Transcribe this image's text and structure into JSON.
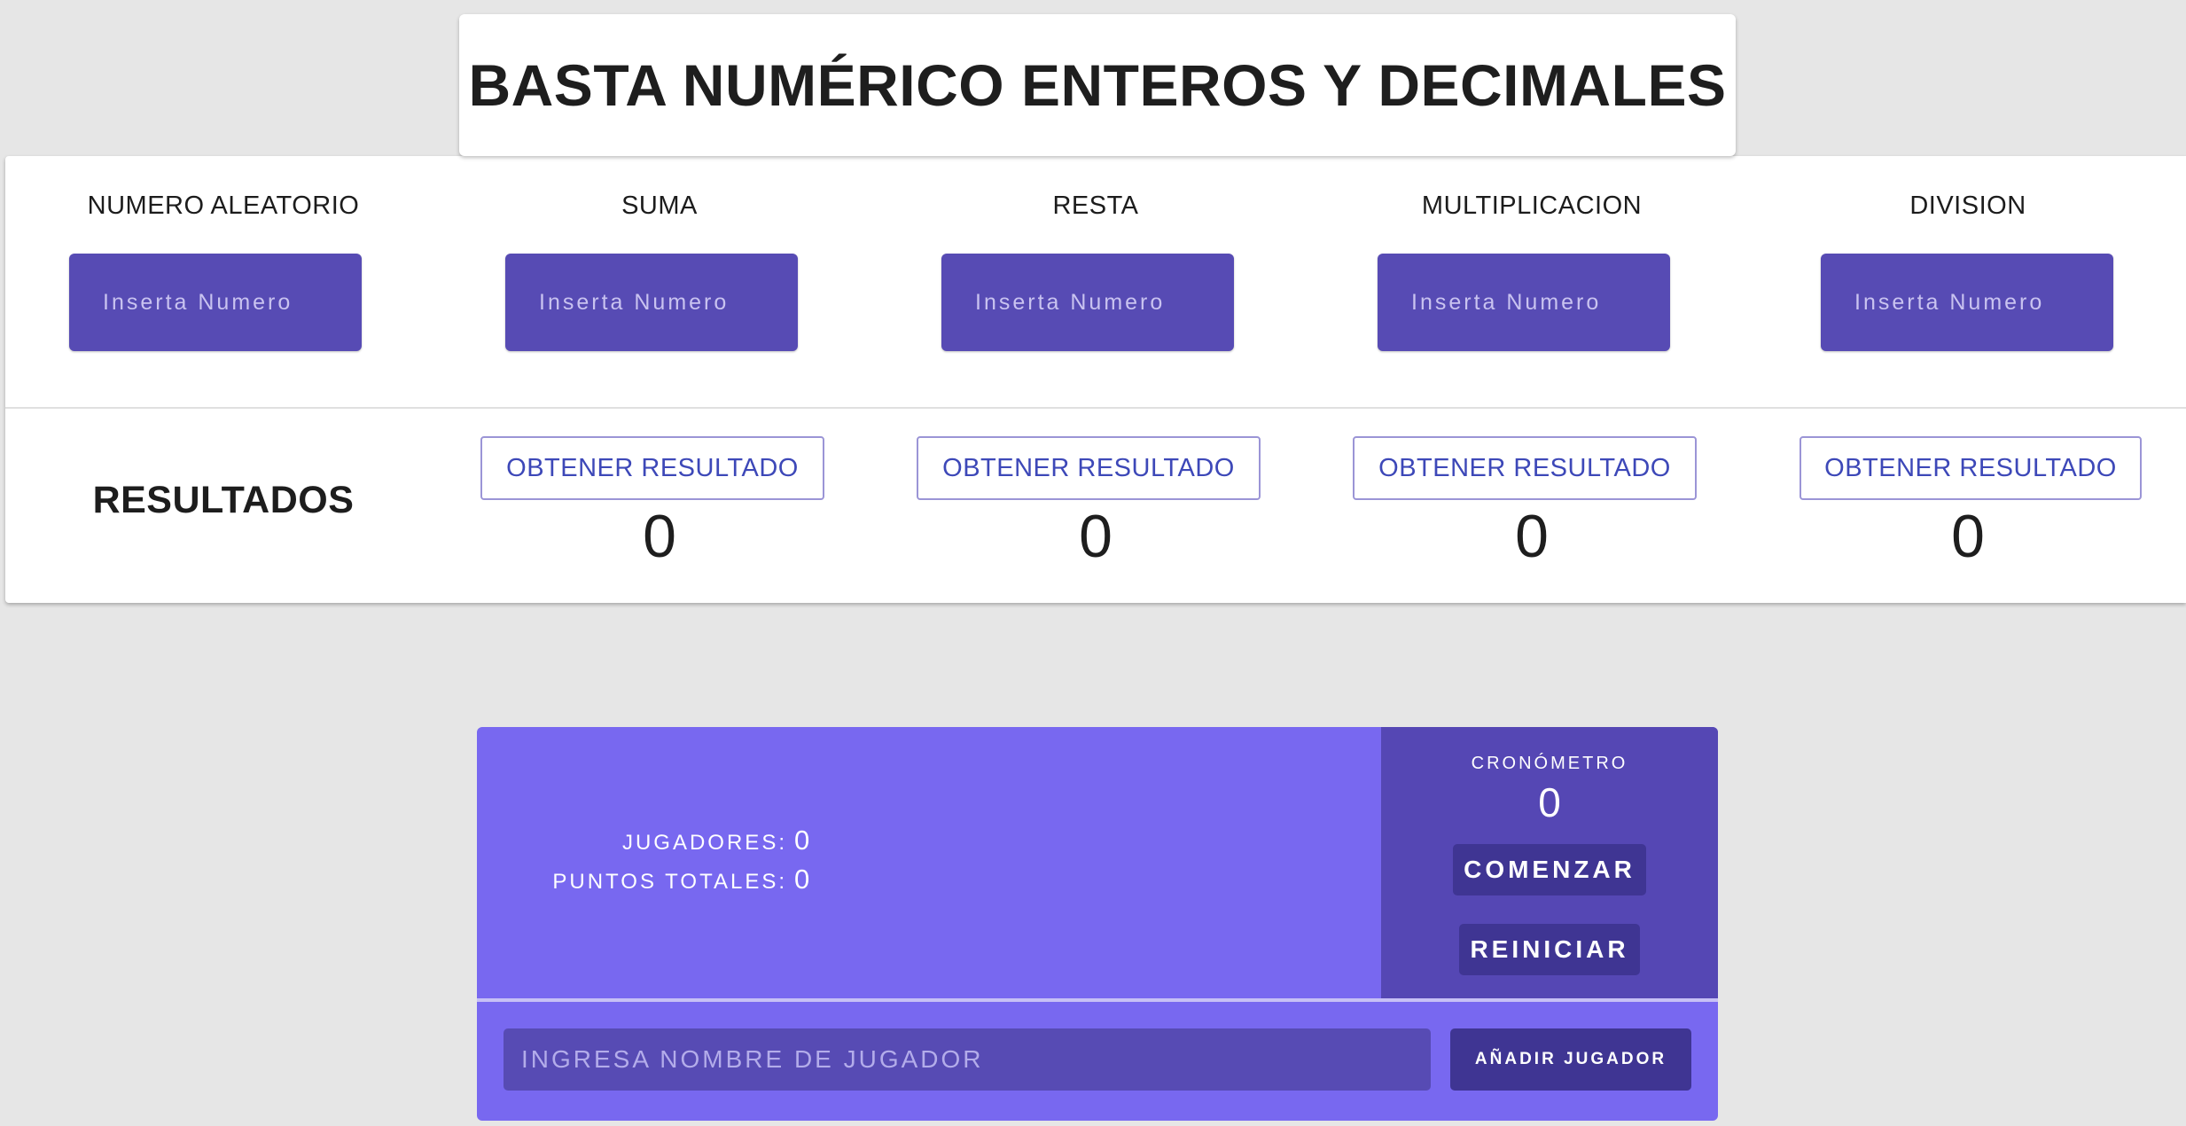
{
  "title": "BASTA NUMÉRICO ENTEROS Y DECIMALES",
  "columns": [
    {
      "header": "NUMERO ALEATORIO",
      "placeholder": "Inserta Numero"
    },
    {
      "header": "SUMA",
      "placeholder": "Inserta Numero"
    },
    {
      "header": "RESTA",
      "placeholder": "Inserta Numero"
    },
    {
      "header": "MULTIPLICACION",
      "placeholder": "Inserta Numero"
    },
    {
      "header": "DIVISION",
      "placeholder": "Inserta Numero"
    }
  ],
  "results": {
    "label": "RESULTADOS",
    "button_label": "OBTENER RESULTADO",
    "values": [
      "0",
      "0",
      "0",
      "0"
    ]
  },
  "stats": {
    "players_label": "JUGADORES:",
    "players_value": "0",
    "points_label": "PUNTOS TOTALES:",
    "points_value": "0"
  },
  "timer": {
    "label": "CRONÓMETRO",
    "value": "0",
    "start_label": "COMENZAR",
    "reset_label": "REINICIAR"
  },
  "player_form": {
    "placeholder": "INGRESA NOMBRE DE JUGADOR",
    "add_label": "AÑADIR JUGADOR"
  },
  "colors": {
    "panel": "#7868f0",
    "input": "#574bb4",
    "button_dark": "#3f3593",
    "result_text": "#3d48b8"
  }
}
